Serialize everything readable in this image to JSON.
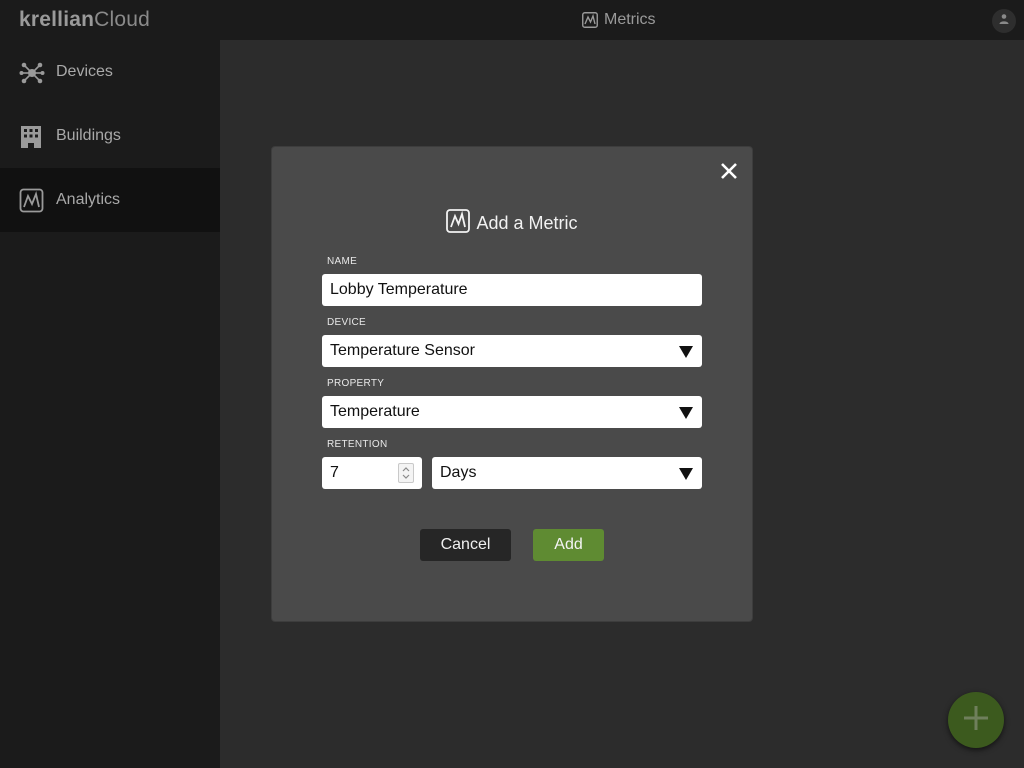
{
  "app": {
    "brand_bold": "krellian",
    "brand_light": "Cloud",
    "header_title": "Metrics"
  },
  "icons": {
    "header": "chart-icon",
    "user": "user-icon",
    "fab": "plus-icon",
    "dialog_title": "chart-icon",
    "close": "close-icon"
  },
  "sidebar": {
    "items": [
      {
        "label": "Devices",
        "icon": "network-icon",
        "selected": false
      },
      {
        "label": "Buildings",
        "icon": "building-icon",
        "selected": false
      },
      {
        "label": "Analytics",
        "icon": "chart-icon",
        "selected": true
      }
    ]
  },
  "dialog": {
    "title": "Add a Metric",
    "name": {
      "label": "NAME",
      "value": "Lobby Temperature"
    },
    "device": {
      "label": "DEVICE",
      "value": "Temperature Sensor"
    },
    "property": {
      "label": "PROPERTY",
      "value": "Temperature"
    },
    "retention": {
      "label": "RETENTION",
      "amount": "7",
      "unit": "Days"
    },
    "cancel_label": "Cancel",
    "add_label": "Add"
  },
  "colors": {
    "background": "#1b1b1b",
    "content": "#2c2c2c",
    "dialog": "#4a4a4a",
    "accent_green": "#5f8b32",
    "fab_green": "#3c5a1e"
  }
}
